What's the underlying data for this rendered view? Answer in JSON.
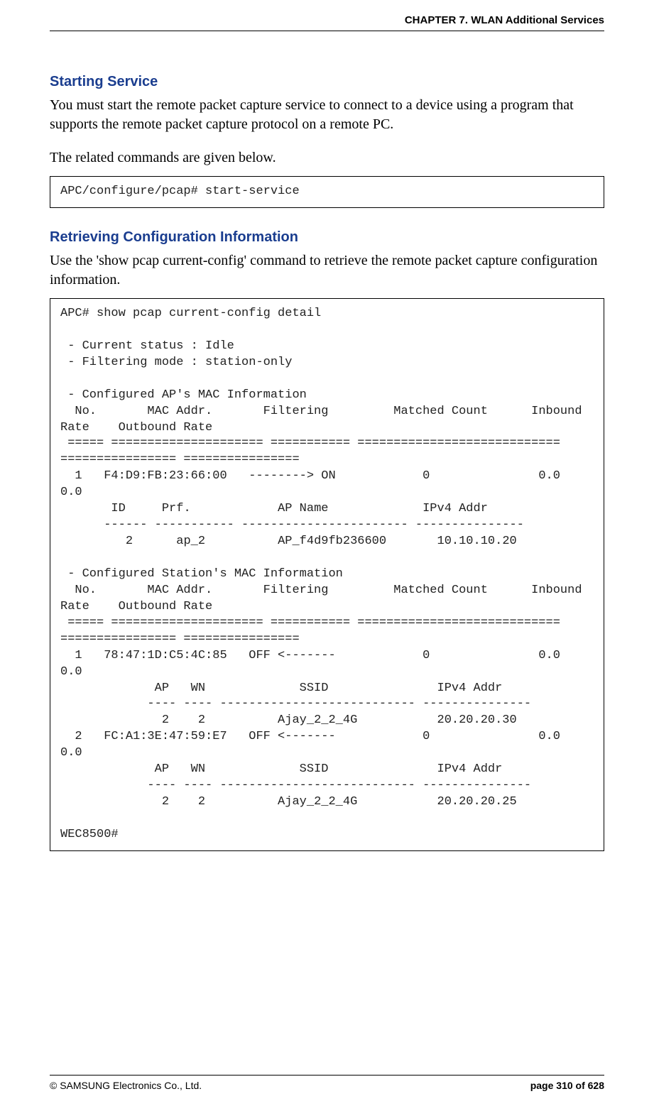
{
  "header": {
    "chapter": "CHAPTER 7. WLAN Additional Services"
  },
  "section1": {
    "heading": "Starting Service",
    "para1": "You must start the remote packet capture service to connect to a device using a program that supports the remote packet capture protocol on a remote PC.",
    "para2": "The related commands are given below.",
    "code": "APC/configure/pcap# start-service"
  },
  "section2": {
    "heading": "Retrieving Configuration Information",
    "para1": "Use the 'show pcap current-config' command to retrieve the remote packet capture configuration information.",
    "code": "APC# show pcap current-config detail\n\n - Current status : Idle\n - Filtering mode : station-only\n\n - Configured AP's MAC Information\n  No.       MAC Addr.       Filtering         Matched Count      Inbound Rate    Outbound Rate\n ===== ===================== =========== ============================ ================ ================\n  1   F4:D9:FB:23:66:00   --------> ON            0               0.0             0.0\n       ID     Prf.            AP Name             IPv4 Addr\n      ------ ----------- ----------------------- ---------------\n         2      ap_2          AP_f4d9fb236600       10.10.10.20\n\n - Configured Station's MAC Information\n  No.       MAC Addr.       Filtering         Matched Count      Inbound Rate    Outbound Rate\n ===== ===================== =========== ============================ ================ ================\n  1   78:47:1D:C5:4C:85   OFF <-------            0               0.0             0.0\n             AP   WN             SSID               IPv4 Addr\n            ---- ---- --------------------------- ---------------\n              2    2          Ajay_2_2_4G           20.20.20.30\n  2   FC:A1:3E:47:59:E7   OFF <-------            0               0.0             0.0\n             AP   WN             SSID               IPv4 Addr\n            ---- ---- --------------------------- ---------------\n              2    2          Ajay_2_2_4G           20.20.20.25\n\nWEC8500#"
  },
  "footer": {
    "left": "© SAMSUNG Electronics Co., Ltd.",
    "right": "page 310 of 628"
  }
}
